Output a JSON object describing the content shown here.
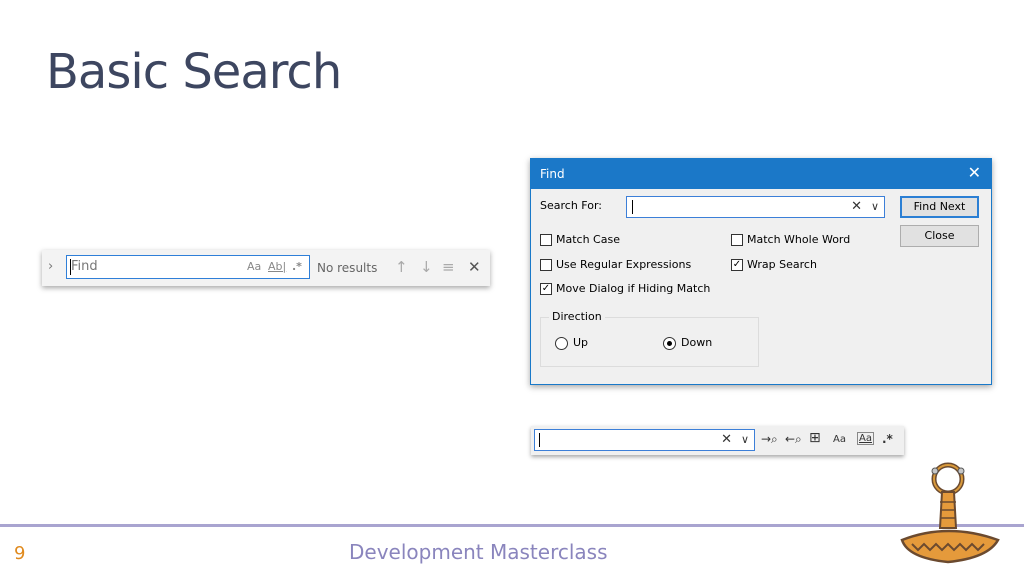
{
  "slide": {
    "title": "Basic Search",
    "page_number": "9",
    "footer": "Development Masterclass"
  },
  "vscode_find": {
    "input_placeholder": "Find",
    "match_case_label": "Aa",
    "whole_word_label": "Ab|",
    "regex_label": ".*",
    "status": "No results"
  },
  "find_dialog": {
    "title": "Find",
    "search_for_label": "Search For:",
    "search_value": "",
    "find_next_label": "Find Next",
    "close_label": "Close",
    "match_case_label": "Match Case",
    "match_case_checked": false,
    "match_whole_word_label": "Match Whole Word",
    "match_whole_word_checked": false,
    "regex_label": "Use Regular Expressions",
    "regex_checked": false,
    "wrap_search_label": "Wrap Search",
    "wrap_search_checked": true,
    "move_dialog_label": "Move Dialog if Hiding Match",
    "move_dialog_checked": true,
    "direction_label": "Direction",
    "up_label": "Up",
    "down_label": "Down",
    "direction_selected": "Down"
  },
  "find_toolbar": {
    "search_value": "",
    "match_case_label": "Aa"
  },
  "colors": {
    "title_text": "#3d4660",
    "dialog_titlebar": "#1b78c8",
    "page_number": "#e08a1e",
    "footer_text": "#8a85bd",
    "footer_line": "#a9a4d0"
  }
}
